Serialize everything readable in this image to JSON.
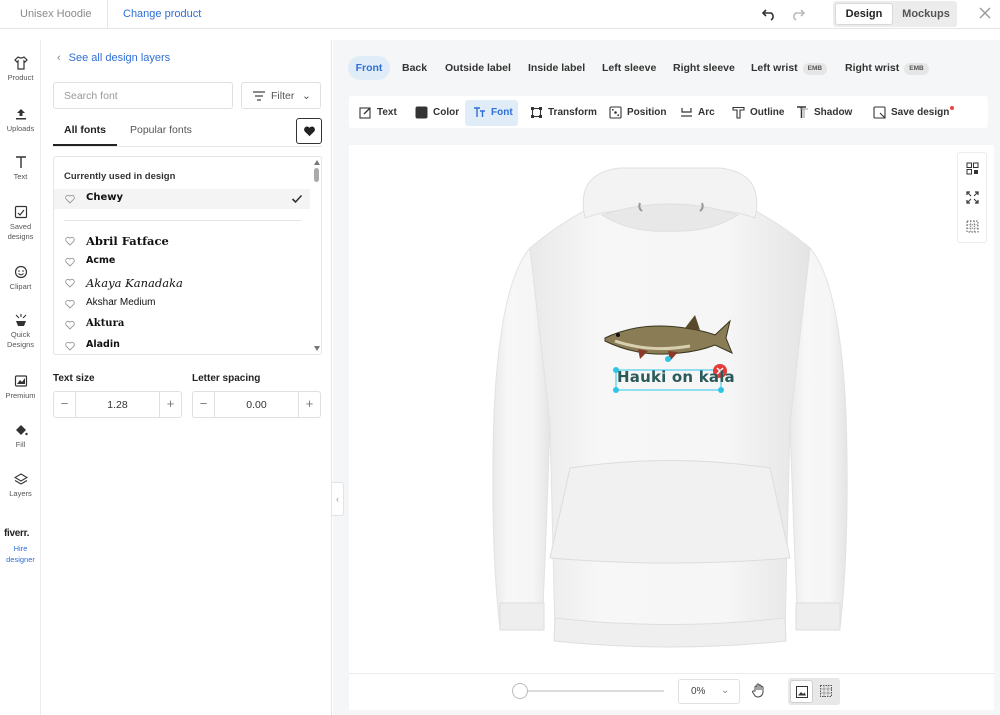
{
  "topbar": {
    "product_name": "Unisex Hoodie",
    "change_product": "Change product",
    "design_label": "Design",
    "mockups_label": "Mockups"
  },
  "rail": {
    "items": [
      {
        "label": "Product",
        "icon": "shirt-icon"
      },
      {
        "label": "Uploads",
        "icon": "upload-icon"
      },
      {
        "label": "Text",
        "icon": "text-icon"
      },
      {
        "label": "Saved designs",
        "icon": "saved-designs-icon"
      },
      {
        "label": "Clipart",
        "icon": "smiley-icon"
      },
      {
        "label": "Quick Designs",
        "icon": "sparkle-icon"
      },
      {
        "label": "Premium",
        "icon": "premium-icon"
      },
      {
        "label": "Fill",
        "icon": "paint-bucket-icon"
      },
      {
        "label": "Layers",
        "icon": "layers-icon"
      }
    ],
    "fiverr_logo": "fiverr.",
    "hire_label": "Hire designer"
  },
  "panel": {
    "back_label": "See all design layers",
    "search_placeholder": "Search font",
    "filter_label": "Filter",
    "tabs": [
      {
        "label": "All fonts",
        "active": true
      },
      {
        "label": "Popular fonts",
        "active": false
      }
    ],
    "currently_used_heading": "Currently used in design",
    "current_font": "Chewy",
    "fonts": [
      "Abril Fatface",
      "Acme",
      "Akaya Kanadaka",
      "Akshar Medium",
      "Aktura",
      "Aladin"
    ],
    "text_size_label": "Text size",
    "text_size_value": "1.28",
    "letter_spacing_label": "Letter spacing",
    "letter_spacing_value": "0.00"
  },
  "placements": [
    {
      "label": "Front",
      "active": true
    },
    {
      "label": "Back"
    },
    {
      "label": "Outside label"
    },
    {
      "label": "Inside label"
    },
    {
      "label": "Left sleeve"
    },
    {
      "label": "Right sleeve"
    },
    {
      "label": "Left wrist",
      "badge": "EMB"
    },
    {
      "label": "Right wrist",
      "badge": "EMB"
    }
  ],
  "toolbar": {
    "text": "Text",
    "color": "Color",
    "font": "Font",
    "transform": "Transform",
    "position": "Position",
    "arc": "Arc",
    "outline": "Outline",
    "shadow": "Shadow",
    "save_design": "Save design"
  },
  "canvas": {
    "design_text": "Hauki on kala",
    "zoom": "0%"
  },
  "colors": {
    "accent": "#2f6fd6",
    "active_bg": "#e0edf9",
    "selection": "#2ec4e6",
    "delete": "#e53a3a"
  }
}
